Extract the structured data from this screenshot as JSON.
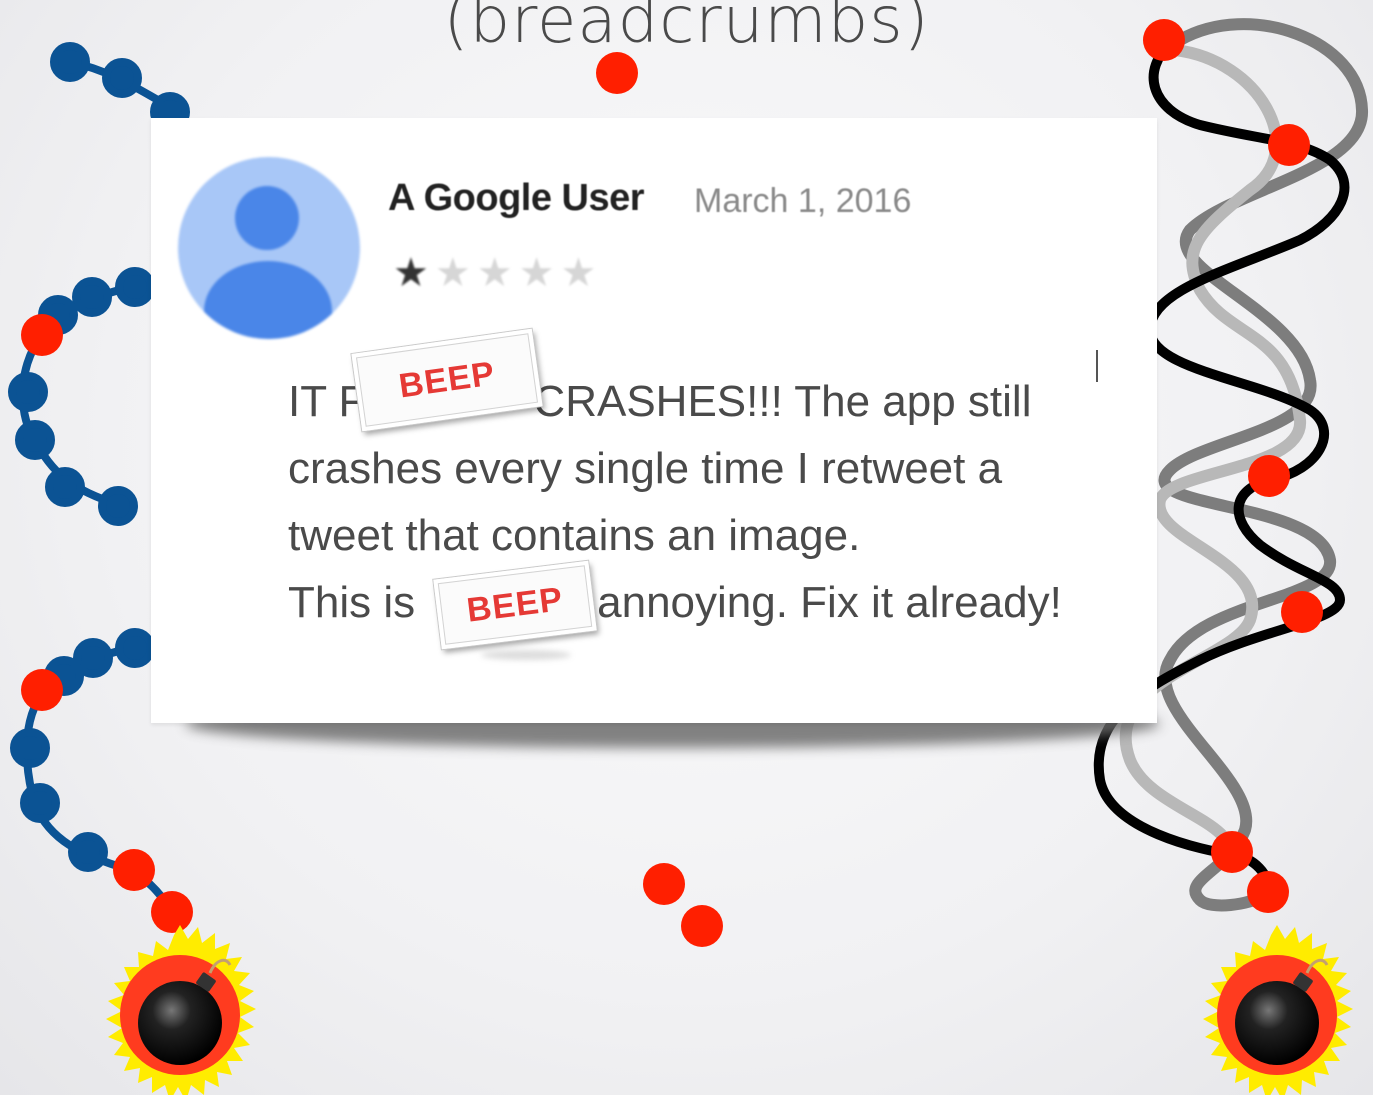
{
  "slide": {
    "title": "(breadcrumbs)"
  },
  "review": {
    "author": "A Google User",
    "date": "March 1, 2016",
    "rating": 1,
    "rating_max": 5,
    "line1_start": "IT F",
    "line1_end": "CRASHES!!! The app still",
    "line2": "crashes every single time I retweet a",
    "line3": "tweet that contains an image.",
    "line4_start": "This is",
    "line4_end": "annoying. Fix it already!"
  },
  "censor": {
    "beep_1": "BEEP",
    "beep_2": "BEEP"
  },
  "icons": {
    "bomb_left": "bomb-icon",
    "bomb_right": "bomb-icon",
    "avatar": "user-avatar-icon",
    "star": "star-icon"
  },
  "colors": {
    "breadcrumb_dot": "#ff1f00",
    "blue_trail": "#0b5394",
    "black_trail": "#000000",
    "gray_trail": "#999999",
    "avatar_bg": "#a8c7f7",
    "avatar_fg": "#4a86e8",
    "beep_text": "#e53935",
    "explosion": "#ff3b1f"
  }
}
